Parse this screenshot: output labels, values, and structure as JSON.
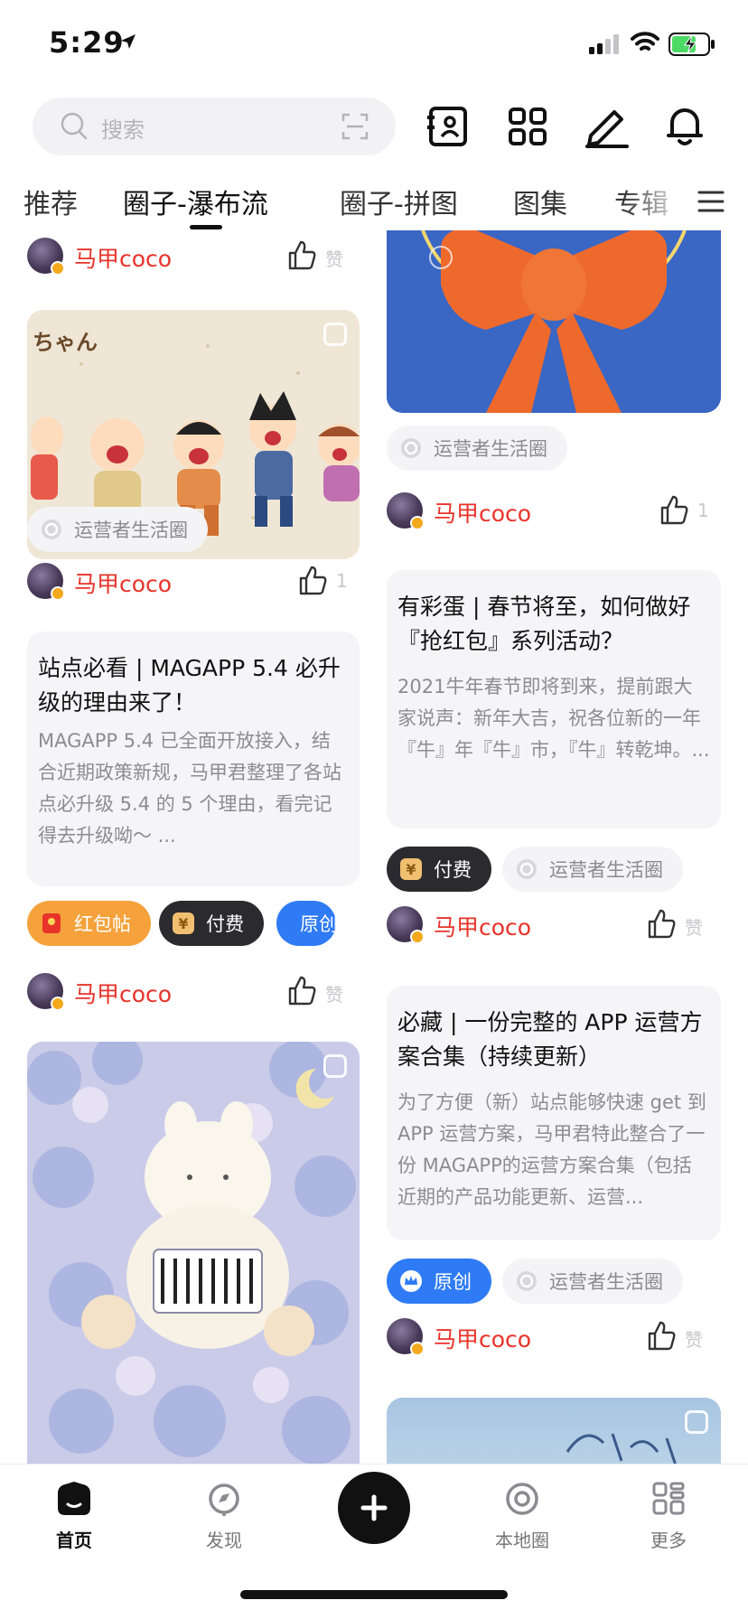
{
  "status_bar": {
    "time": "5:29"
  },
  "search": {
    "placeholder": "搜索"
  },
  "tabs": [
    {
      "label": "推荐"
    },
    {
      "label": "圈子-瀑布流",
      "active": true
    },
    {
      "label": "圈子-拼图"
    },
    {
      "label": "图集"
    },
    {
      "label": "专辑"
    }
  ],
  "colors": {
    "author": "#e8332a",
    "tag_dark": "#2b2b2f",
    "tag_orange": "#f5a23c",
    "tag_blue": "#2f7bf5"
  },
  "left_column": {
    "author_1": {
      "name": "马甲coco",
      "likes": "赞"
    },
    "post_1_tag": "运营者生活圈",
    "author_2": {
      "name": "马甲coco",
      "likes": "1"
    },
    "post_2": {
      "title": "站点必看 | MAGAPP 5.4 必升级的理由来了！",
      "body": "MAGAPP 5.4 已全面开放接入，结合近期政策新规，马甲君整理了各站点必升级 5.4 的 5 个理由，看完记得去升级呦～ ..."
    },
    "post_2_tags": [
      "红包帖",
      "付费",
      "原创"
    ],
    "author_3": {
      "name": "马甲coco",
      "likes": "赞"
    }
  },
  "right_column": {
    "post_1_tag": "运营者生活圈",
    "author_1": {
      "name": "马甲coco",
      "likes": "1"
    },
    "post_2": {
      "title": "有彩蛋 | 春节将至，如何做好『抢红包』系列活动？",
      "body": "2021牛年春节即将到来，提前跟大家说声：新年大吉，祝各位新的一年『牛』年『牛』市，『牛』转乾坤。..."
    },
    "post_2_tags": [
      "付费",
      "运营者生活圈"
    ],
    "author_2": {
      "name": "马甲coco",
      "likes": "赞"
    },
    "post_3": {
      "title": "必藏 | 一份完整的 APP 运营方案合集（持续更新）",
      "body": "为了方便（新）站点能够快速 get 到 APP 运营方案，马甲君特此整合了一份 MAGAPP的运营方案合集（包括近期的产品功能更新、运营..."
    },
    "post_3_tags": [
      "原创",
      "运营者生活圈"
    ],
    "author_3": {
      "name": "马甲coco",
      "likes": "赞"
    }
  },
  "bottom_nav": [
    {
      "label": "首页",
      "icon": "home-icon",
      "active": true
    },
    {
      "label": "发现",
      "icon": "discover-icon"
    },
    {
      "label": "",
      "icon": "plus-icon"
    },
    {
      "label": "本地圈",
      "icon": "local-circle-icon"
    },
    {
      "label": "更多",
      "icon": "more-grid-icon"
    }
  ]
}
